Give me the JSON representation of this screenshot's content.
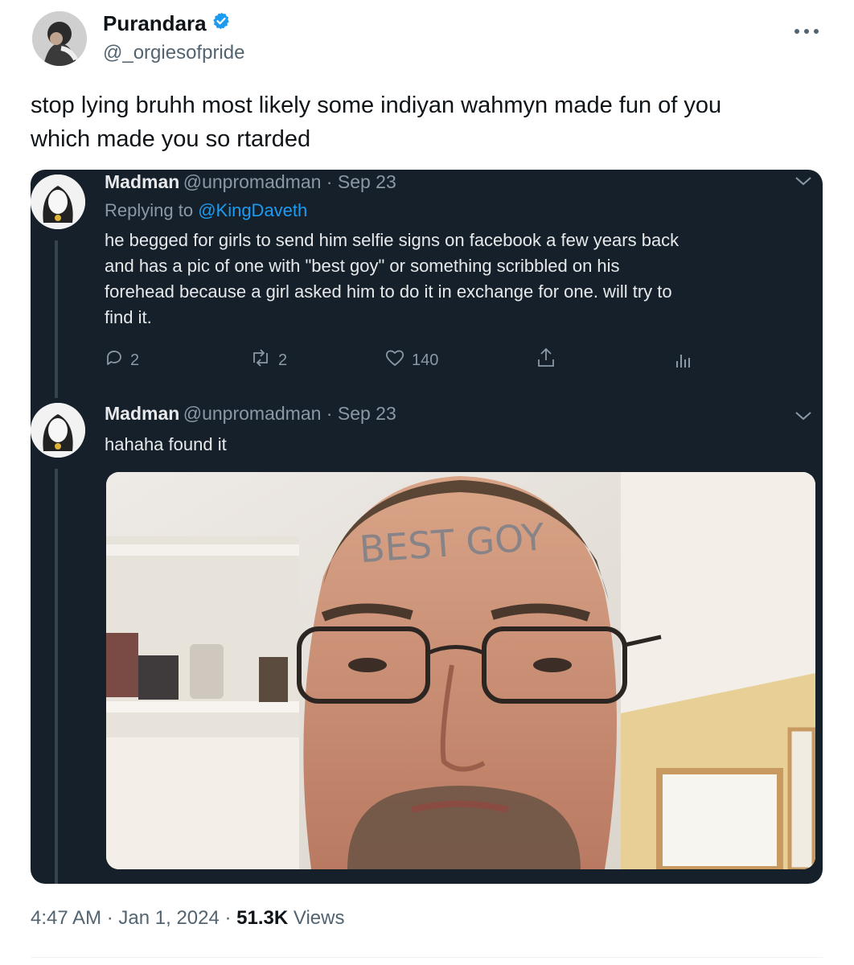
{
  "author": {
    "name": "Purandara",
    "handle": "@_orgiesofpride",
    "verified": true
  },
  "tweet": {
    "text_line1": "stop lying bruhh most likely some indiyan wahmyn made fun of you",
    "text_line2": "which made you so rtarded"
  },
  "embedded": {
    "post1": {
      "name": "Madman",
      "handle_date": "@unpromadman · Sep 23",
      "replying_prefix": "Replying to ",
      "replying_to": "@KingDaveth",
      "lines": [
        "he begged for girls to send him selfie signs on facebook a few years back",
        "and has a pic of one with \"best goy\" or something scribbled on his",
        "forehead because a girl asked him to do it in exchange for one. will try to",
        "find it."
      ],
      "replies": "2",
      "retweets": "2",
      "likes": "140"
    },
    "post2": {
      "name": "Madman",
      "handle_date": "@unpromadman · Sep 23",
      "text": "hahaha found it",
      "forehead_text": "BEST GOY"
    }
  },
  "footer": {
    "time": "4:47 AM",
    "sep1": " · ",
    "date": "Jan 1, 2024",
    "sep2": " · ",
    "views_count": "51.3K",
    "views_label": " Views"
  },
  "colors": {
    "verified": "#1d9bf0",
    "embed_bg": "#15202b",
    "link": "#1d9bf0"
  },
  "icons": [
    "more-icon",
    "verified-badge-icon",
    "reply-icon",
    "retweet-icon",
    "like-icon",
    "share-icon",
    "analytics-icon",
    "chevron-down-icon"
  ]
}
